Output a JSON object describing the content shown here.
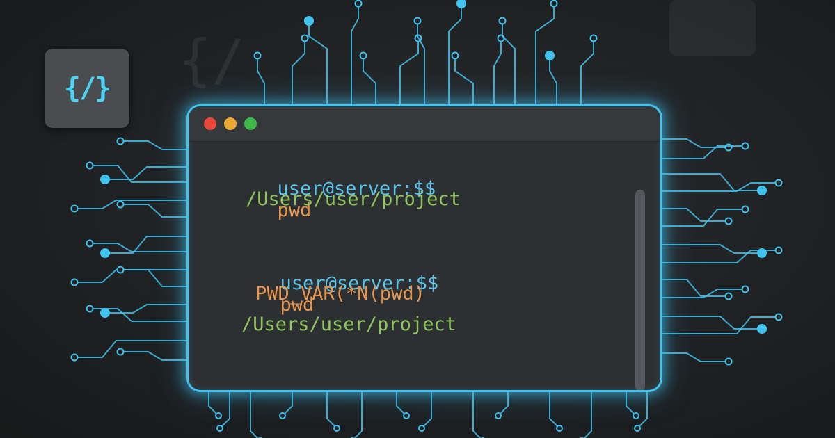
{
  "badge": {
    "text": "{/}"
  },
  "colors": {
    "accent": "#41c3f0",
    "prompt": "#5bc4ea",
    "command": "#e8964d",
    "output": "#8fc55c",
    "dot_red": "#e9483f",
    "dot_yellow": "#eba934",
    "dot_green": "#3fb84a"
  },
  "terminal": {
    "window_controls": [
      "close",
      "minimize",
      "maximize"
    ],
    "lines": [
      {
        "prompt": "user@server:$$",
        "command": "pwd"
      },
      {
        "output": "/Users/user/project"
      },
      {
        "prompt": "user@server:$$",
        "command": "pwd"
      },
      {
        "command_output": "PWD_VAR(*N(pwd)"
      },
      {
        "output": "/Users/user/project"
      }
    ]
  }
}
